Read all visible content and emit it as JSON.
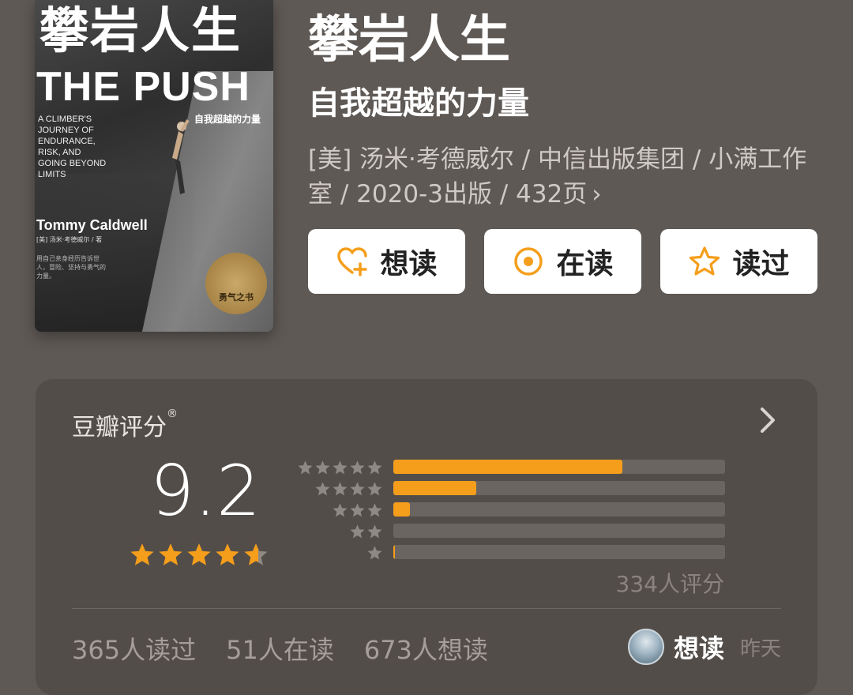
{
  "cover": {
    "title_cn": "攀岩人生",
    "title_en": "THE PUSH",
    "subtitle_cn": "自我超越的力量",
    "subtitle_en": "A CLIMBER'S\nJOURNEY OF\nENDURANCE,\nRISK, AND\nGOING BEYOND\nLIMITS",
    "author": "Tommy Caldwell",
    "credit": "[美] 汤米·考德威尔 / 著",
    "blurb": "用自己亲身经历告诉世人，冒险、坚持与勇气的力量。",
    "seal": "勇气之书"
  },
  "book": {
    "title": "攀岩人生",
    "subtitle": "自我超越的力量",
    "meta": "[美] 汤米·考德威尔 / 中信出版集团 / 小满工作室 / 2020-3出版 / 432页",
    "meta_chevron": "›"
  },
  "actions": {
    "want": "想读",
    "reading": "在读",
    "read": "读过"
  },
  "rating": {
    "label": "豆瓣评分",
    "reg_mark": "®",
    "score": "9.2",
    "stars": 4.6,
    "distribution": [
      {
        "stars": 5,
        "fraction": 0.69
      },
      {
        "stars": 4,
        "fraction": 0.25
      },
      {
        "stars": 3,
        "fraction": 0.05
      },
      {
        "stars": 2,
        "fraction": 0.0
      },
      {
        "stars": 1,
        "fraction": 0.005
      }
    ],
    "count": "334人评分"
  },
  "stats": {
    "read": "365人读过",
    "reading": "51人在读",
    "want": "673人想读"
  },
  "friend": {
    "action": "想读",
    "time": "昨天"
  },
  "colors": {
    "background": "#5f5955",
    "card": "#534d49",
    "accent": "#f59e1b",
    "star_grey": "#8f8984"
  }
}
